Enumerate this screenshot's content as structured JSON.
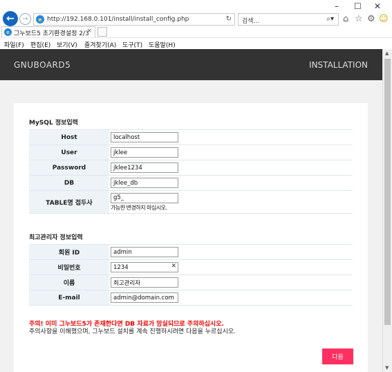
{
  "browser": {
    "url": "http://192.168.0.101/install/install_config.php",
    "search_placeholder": "검색...",
    "tab_title": "그누보드5 초기환경설정 2/3",
    "tab_close": "×",
    "menu": [
      "파일(F)",
      "편집(E)",
      "보기(V)",
      "즐겨찾기(A)",
      "도구(T)",
      "도움말(H)"
    ],
    "window_controls": [
      "–",
      "☐",
      "✕"
    ]
  },
  "header": {
    "logo": "GNUBOARD5",
    "right": "INSTALLATION"
  },
  "mysql": {
    "title": "MySQL 정보입력",
    "rows": [
      {
        "label": "Host",
        "value": "localhost"
      },
      {
        "label": "User",
        "value": "jklee"
      },
      {
        "label": "Password",
        "value": "jklee1234"
      },
      {
        "label": "DB",
        "value": "jklee_db"
      },
      {
        "label": "TABLE명 접두사",
        "value": "g5_",
        "help": "가능한 변경하지 마십시오."
      }
    ]
  },
  "admin": {
    "title": "최고관리자 정보입력",
    "rows": [
      {
        "label": "회원 ID",
        "value": "admin"
      },
      {
        "label": "비밀번호",
        "value": "1234"
      },
      {
        "label": "이름",
        "value": "최고관리자"
      },
      {
        "label": "E-mail",
        "value": "admin@domain.com"
      }
    ]
  },
  "warning": "주의! 이미 그누보드5가 존재한다면 DB 자료가 망실되므로 주의하십시오.",
  "note": "주의사항을 이해했으며, 그누보드 설치를 계속 진행하시려면 다음을 누르십시오.",
  "next_label": "다음",
  "colors": {
    "header_bg": "#333333",
    "button": "#ff3061",
    "warning": "#ee0000",
    "label_bg": "#eef3f8"
  }
}
